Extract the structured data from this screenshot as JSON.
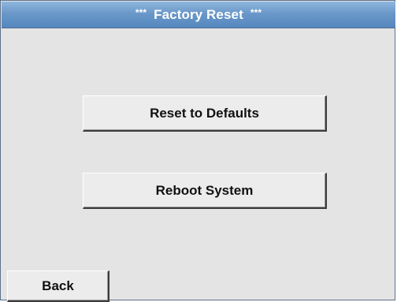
{
  "window": {
    "title": "Factory Reset",
    "title_decoration": "***"
  },
  "actions": {
    "reset_defaults_label": "Reset to Defaults",
    "reboot_system_label": "Reboot System"
  },
  "footer": {
    "back_label": "Back"
  },
  "colors": {
    "title_bar": "#6b98c9",
    "screen_background": "#e4e4e4",
    "button_face": "#ececec"
  }
}
